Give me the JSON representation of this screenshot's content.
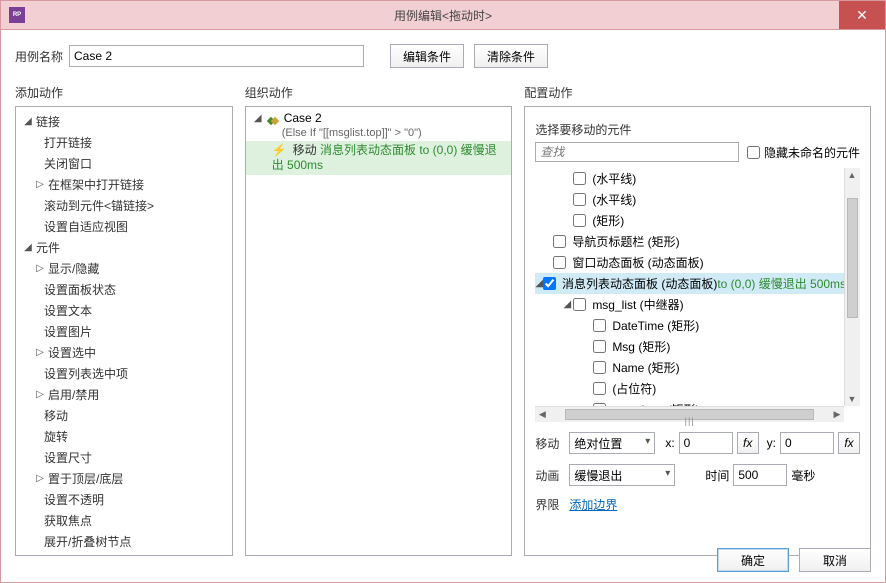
{
  "titlebar": {
    "title": "用例编辑<拖动时>",
    "app_icon_text": "RP"
  },
  "top": {
    "name_label": "用例名称",
    "name_value": "Case 2",
    "edit_cond": "编辑条件",
    "clear_cond": "清除条件"
  },
  "headers": {
    "add_action": "添加动作",
    "organize": "组织动作",
    "configure": "配置动作"
  },
  "left_tree": {
    "links": {
      "label": "链接",
      "items": [
        "打开链接",
        "关闭窗口",
        "在框架中打开链接",
        "滚动到元件<锚链接>",
        "设置自适应视图"
      ]
    },
    "widgets": {
      "label": "元件",
      "items": [
        "显示/隐藏",
        "设置面板状态",
        "设置文本",
        "设置图片",
        "设置选中",
        "设置列表选中项",
        "启用/禁用",
        "移动",
        "旋转",
        "设置尺寸",
        "置于顶层/底层",
        "设置不透明",
        "获取焦点",
        "展开/折叠树节点"
      ]
    },
    "expandable_indices": [
      2
    ]
  },
  "organize": {
    "case_name": "Case 2",
    "condition": "(Else If \"[[msglist.top]]\" > \"0\")",
    "action_prefix": "移动",
    "action_target": " 消息列表动态面板 to (0,0) 缓慢退出 500ms"
  },
  "right": {
    "select_label": "选择要移动的元件",
    "search_placeholder": "查找",
    "hide_unnamed": "隐藏未命名的元件",
    "tree": [
      {
        "level": 2,
        "checked": false,
        "label": "(水平线)"
      },
      {
        "level": 2,
        "checked": false,
        "label": "(水平线)"
      },
      {
        "level": 2,
        "checked": false,
        "label": "(矩形)"
      },
      {
        "level": 1,
        "checked": false,
        "label": "导航页标题栏 (矩形)"
      },
      {
        "level": 1,
        "checked": false,
        "label": "窗口动态面板 (动态面板)"
      },
      {
        "level": 1,
        "checked": true,
        "caret": "◢",
        "sel": true,
        "label": "消息列表动态面板 (动态面板)",
        "suffix": " to (0,0) 缓慢退出 500ms"
      },
      {
        "level": 2,
        "checked": false,
        "caret": "◢",
        "label": "msg_list (中继器)"
      },
      {
        "level": 3,
        "checked": false,
        "label": "DateTime (矩形)"
      },
      {
        "level": 3,
        "checked": false,
        "label": "Msg (矩形)"
      },
      {
        "level": 3,
        "checked": false,
        "label": "Name (矩形)"
      },
      {
        "level": 3,
        "checked": false,
        "label": "(占位符)"
      },
      {
        "level": 3,
        "checked": false,
        "label": "msg_item (矩形)"
      }
    ],
    "move": {
      "label": "移动",
      "mode": "绝对位置",
      "x_label": "x:",
      "x": "0",
      "y_label": "y:",
      "y": "0",
      "fx": "fx"
    },
    "anim": {
      "label": "动画",
      "easing": "缓慢退出",
      "time_label": "时间",
      "time": "500",
      "unit": "毫秒"
    },
    "bounds": {
      "label": "界限",
      "link": "添加边界"
    }
  },
  "footer": {
    "ok": "确定",
    "cancel": "取消"
  }
}
